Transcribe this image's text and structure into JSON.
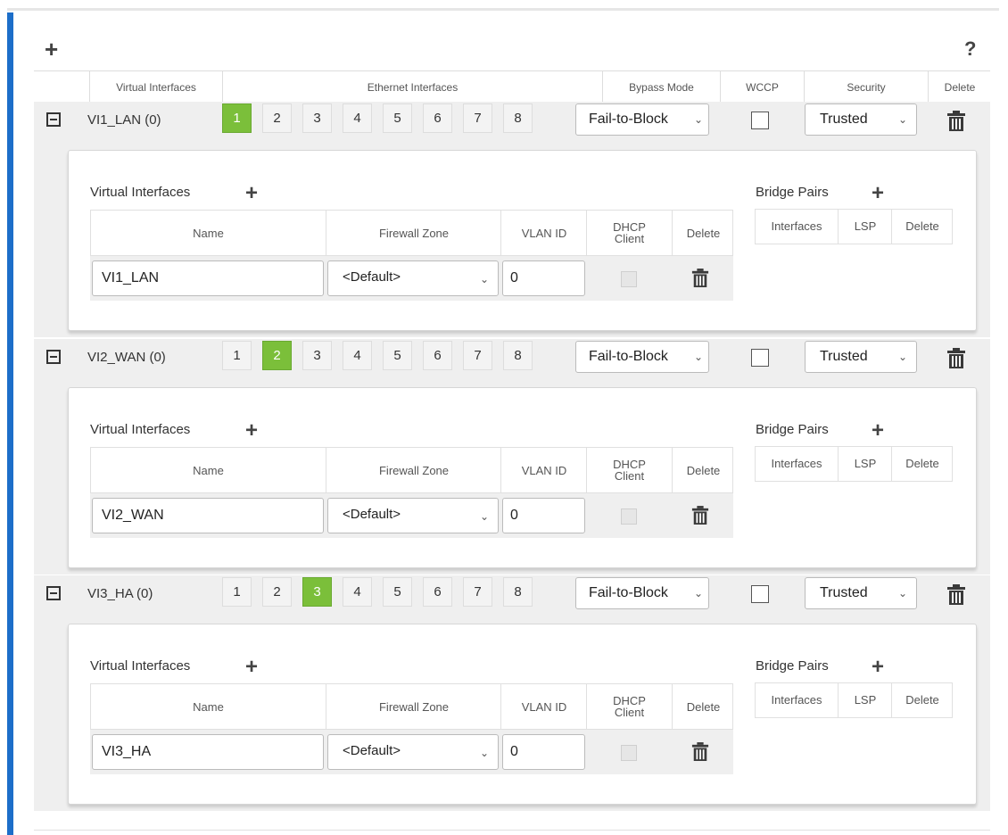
{
  "toolbar": {
    "add_label": "+",
    "help_label": "?"
  },
  "header": {
    "virtual_interfaces": "Virtual Interfaces",
    "ethernet_interfaces": "Ethernet Interfaces",
    "bypass_mode": "Bypass Mode",
    "wccp": "WCCP",
    "security": "Security",
    "delete": "Delete"
  },
  "ethernet_ports": [
    "1",
    "2",
    "3",
    "4",
    "5",
    "6",
    "7",
    "8"
  ],
  "sections": [
    {
      "name": "VI1_LAN (0)",
      "active_port": "1",
      "bypass_mode": "Fail-to-Block",
      "wccp": false,
      "security": "Trusted",
      "vi_name": "VI1_LAN",
      "firewall_zone": "<Default>",
      "vlan_id": "0",
      "dhcp_client": false
    },
    {
      "name": "VI2_WAN (0)",
      "active_port": "2",
      "bypass_mode": "Fail-to-Block",
      "wccp": false,
      "security": "Trusted",
      "vi_name": "VI2_WAN",
      "firewall_zone": "<Default>",
      "vlan_id": "0",
      "dhcp_client": false
    },
    {
      "name": "VI3_HA (0)",
      "active_port": "3",
      "bypass_mode": "Fail-to-Block",
      "wccp": false,
      "security": "Trusted",
      "vi_name": "VI3_HA",
      "firewall_zone": "<Default>",
      "vlan_id": "0",
      "dhcp_client": false
    }
  ],
  "panel": {
    "virtual_interfaces_title": "Virtual Interfaces",
    "bridge_pairs_title": "Bridge Pairs",
    "plus": "+",
    "cols": {
      "name": "Name",
      "firewall_zone": "Firewall Zone",
      "vlan_id": "VLAN ID",
      "dhcp_client": "DHCP Client",
      "delete": "Delete"
    },
    "bp_cols": {
      "interfaces": "Interfaces",
      "lsp": "LSP",
      "delete": "Delete"
    }
  },
  "colors": {
    "accent": "#1c6ec9",
    "active_port": "#7bbf3a",
    "section_bg": "#efefef"
  },
  "icons": {
    "delete": "trash-icon",
    "collapse": "minus-square-icon",
    "dropdown": "chevron-down-icon"
  }
}
